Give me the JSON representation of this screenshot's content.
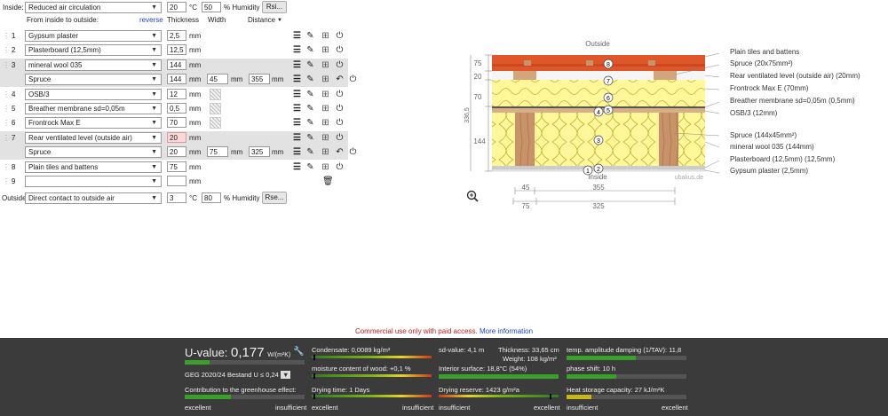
{
  "inside": {
    "label": "Inside:",
    "select": "Reduced air circulation",
    "temp": "20",
    "temp_unit": "°C",
    "humidity": "50",
    "humidity_unit": "% Humidity",
    "rsi_button": "Rsi..."
  },
  "headers": {
    "from": "From inside to outside:",
    "reverse": "reverse",
    "thickness": "Thickness",
    "width": "Width",
    "distance": "Distance"
  },
  "layers": [
    {
      "num": "1",
      "material": "Gypsum plaster",
      "thickness": "2,5",
      "unit": "mm"
    },
    {
      "num": "2",
      "material": "Plasterboard (12,5mm)",
      "thickness": "12,5",
      "unit": "mm"
    },
    {
      "num": "3",
      "material": "mineral wool 035",
      "thickness": "144",
      "unit": "mm"
    },
    {
      "num": "",
      "material": "Spruce",
      "thickness": "144",
      "unit": "mm",
      "width": "45",
      "width_unit": "mm",
      "distance": "355",
      "distance_unit": "mm"
    },
    {
      "num": "4",
      "material": "OSB/3",
      "thickness": "12",
      "unit": "mm"
    },
    {
      "num": "5",
      "material": "Breather membrane sd=0,05m",
      "thickness": "0,5",
      "unit": "mm"
    },
    {
      "num": "6",
      "material": "Frontrock Max E",
      "thickness": "70",
      "unit": "mm"
    },
    {
      "num": "7",
      "material": "Rear ventilated level (outside air)",
      "thickness": "20",
      "unit": "mm"
    },
    {
      "num": "",
      "material": "Spruce",
      "thickness": "20",
      "unit": "mm",
      "width": "75",
      "width_unit": "mm",
      "distance": "325",
      "distance_unit": "mm"
    },
    {
      "num": "8",
      "material": "Plain tiles and battens",
      "thickness": "75",
      "unit": "mm"
    },
    {
      "num": "9",
      "material": "",
      "thickness": "",
      "unit": "mm"
    }
  ],
  "outside": {
    "label": "Outside",
    "select": "Direct contact to outside air",
    "temp": "3",
    "temp_unit": "°C",
    "humidity": "80",
    "humidity_unit": "% Humidity",
    "rse_button": "Rse..."
  },
  "diagram": {
    "outside_label": "Outside",
    "inside_label": "Inside",
    "watermark": "ubakus.de",
    "dims_left": [
      "75",
      "20",
      "70",
      "144"
    ],
    "total": "336,5",
    "dims_bottom_top": [
      "45",
      "355"
    ],
    "dims_bottom_bot": [
      "75",
      "325"
    ],
    "legend": [
      "Plain tiles and battens",
      "Spruce (20x75mm²)",
      "Rear ventilated level (outside air) (20mm)",
      "Frontrock Max E (70mm)",
      "Breather membrane sd=0,05m (0,5mm)",
      "OSB/3 (12mm)",
      "Spruce (144x45mm²)",
      "mineral wool 035 (144mm)",
      "Plasterboard (12,5mm) (12,5mm)",
      "Gypsum plaster (2,5mm)"
    ],
    "markers": [
      "8",
      "7",
      "6",
      "5",
      "4",
      "3",
      "2",
      "1"
    ]
  },
  "notice": {
    "text": "Commercial use only with paid access.",
    "link": "More information"
  },
  "results": {
    "uvalue_label": "U-value:",
    "uvalue": "0,177",
    "uvalue_unit": "W/(m²K)",
    "geg": "GEG 2020/24 Bestand U ≤ 0,24",
    "greenhouse": "Contribution to the greenhouse effect:",
    "condensate": "Condensate: 0,0089 kg/m²",
    "moisture": "moisture content of wood: +0,1 %",
    "drying_time": "Drying time: 1 Days",
    "sd_value": "sd-value: 4,1 m",
    "thickness": "Thickness: 33,65 cm",
    "weight": "Weight: 108 kg/m²",
    "interior_surface": "Interior surface: 18,8°C (54%)",
    "drying_reserve": "Drying reserve: 1423 g/m²a",
    "temp_amp": "temp. amplitude damping (1/TAV): 11,8",
    "phase_shift": "phase shift: 10 h",
    "heat_storage": "Heat storage capacity: 27 kJ/m²K",
    "excellent": "excellent",
    "insufficient": "insufficient"
  }
}
